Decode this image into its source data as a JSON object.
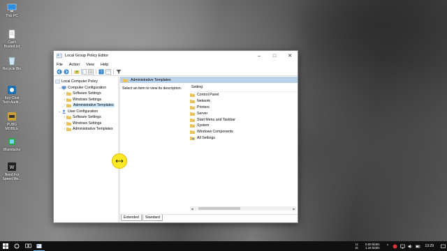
{
  "desktop": {
    "icons": [
      {
        "label": "This PC",
        "icon": "computer-icon"
      },
      {
        "label": "Can't Busted.txt",
        "icon": "text-file-icon"
      },
      {
        "label": "Recycle Bin",
        "icon": "recycle-bin-icon"
      },
      {
        "label": "Key-Chat Tech Audit...",
        "icon": "app-icon"
      },
      {
        "label": "PUBG MOBILE",
        "icon": "game-icon"
      },
      {
        "label": "Bluestacks",
        "icon": "bluestacks-icon"
      },
      {
        "label": "Need For Speed Mo...",
        "icon": "game-icon"
      }
    ]
  },
  "window": {
    "title": "Local Group Policy Editor",
    "controls": {
      "minimize": "–",
      "maximize": "□",
      "close": "✕"
    },
    "menu": [
      "File",
      "Action",
      "View",
      "Help"
    ],
    "tree": [
      {
        "label": "Local Computer Policy",
        "level": 0,
        "chev": ""
      },
      {
        "label": "Computer Configuration",
        "level": 1,
        "chev": "⌄"
      },
      {
        "label": "Software Settings",
        "level": 2,
        "chev": "›"
      },
      {
        "label": "Windows Settings",
        "level": 2,
        "chev": "›"
      },
      {
        "label": "Administrative Templates",
        "level": 2,
        "chev": "›"
      },
      {
        "label": "User Configuration",
        "level": 1,
        "chev": "⌄"
      },
      {
        "label": "Software Settings",
        "level": 2,
        "chev": "›"
      },
      {
        "label": "Windows Settings",
        "level": 2,
        "chev": "›"
      },
      {
        "label": "Administrative Templates",
        "level": 2,
        "chev": "›"
      }
    ],
    "right": {
      "header": "Administrative Templates",
      "description": "Select an item to view its description.",
      "column_header": "Setting",
      "items": [
        "Control Panel",
        "Network",
        "Printers",
        "Server",
        "Start Menu and Taskbar",
        "System",
        "Windows Components",
        "All Settings"
      ]
    },
    "tabs": [
      "Extended",
      "Standard"
    ]
  },
  "taskbar": {
    "net_up_label": "U:",
    "net_up": "0.00 kbit/s",
    "net_down_label": "D:",
    "net_down": "1.34 kbit/s",
    "clock": "13:29"
  },
  "colors": {
    "selection": "#cce8ff",
    "header_bg": "#b9d1ea",
    "folder": "#e8c25c",
    "cursor_highlight": "#ffe600"
  }
}
